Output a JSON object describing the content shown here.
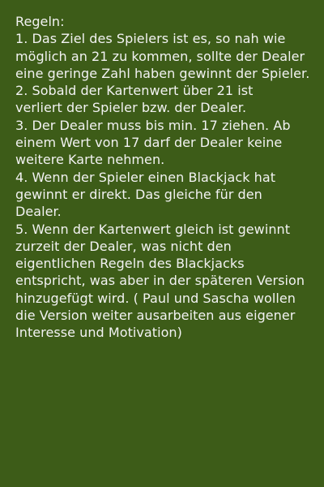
{
  "rules": {
    "title": "Regeln:",
    "lines": [
      "1. Das Ziel des Spielers ist es, so nah wie",
      "möglich an 21 zu kommen, sollte der Dealer",
      "eine geringe Zahl haben gewinnt der Spieler.",
      "2. Sobald der Kartenwert über 21 ist",
      "verliert der Spieler bzw. der Dealer.",
      "3. Der Dealer muss bis min. 17 ziehen. Ab",
      "einem Wert von 17 darf der Dealer keine",
      "weitere Karte nehmen.",
      "4. Wenn der Spieler einen Blackjack hat",
      "gewinnt er direkt. Das gleiche für den",
      "Dealer.",
      "5. Wenn der Kartenwert gleich ist gewinnt",
      "zurzeit der Dealer, was nicht den",
      "eigentlichen Regeln des Blackjacks",
      "entspricht, was aber in der späteren Version",
      "hinzugefügt wird. ( Paul und Sascha wollen",
      "die Version weiter ausarbeiten aus eigener",
      "Interesse und Motivation)"
    ]
  },
  "colors": {
    "background": "#3d5c18",
    "text": "#f2f2f2"
  }
}
